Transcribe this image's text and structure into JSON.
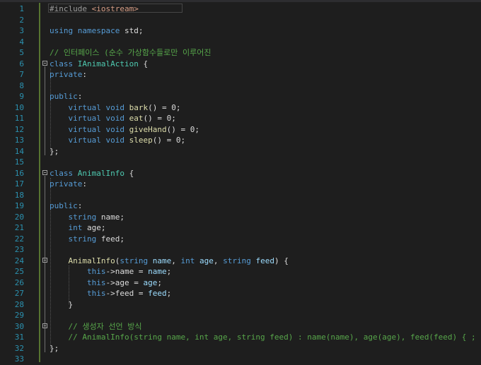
{
  "editor": {
    "lines": [
      {
        "n": "1",
        "segs": [
          {
            "c": "pp",
            "t": "#include "
          },
          {
            "c": "str",
            "t": "<iostream>"
          }
        ]
      },
      {
        "n": "2",
        "segs": []
      },
      {
        "n": "3",
        "segs": [
          {
            "c": "kw",
            "t": "using namespace "
          },
          {
            "c": "id",
            "t": "std;"
          }
        ]
      },
      {
        "n": "4",
        "segs": []
      },
      {
        "n": "5",
        "segs": [
          {
            "c": "cm",
            "t": "// 인터페이스 (순수 가상함수들로만 이루어진"
          }
        ]
      },
      {
        "n": "6",
        "segs": [
          {
            "c": "kw",
            "t": "class "
          },
          {
            "c": "ty",
            "t": "IAnimalAction"
          },
          {
            "c": "id",
            "t": " {"
          }
        ]
      },
      {
        "n": "7",
        "segs": [
          {
            "c": "kw",
            "t": "private"
          },
          {
            "c": "id",
            "t": ":"
          }
        ]
      },
      {
        "n": "8",
        "segs": []
      },
      {
        "n": "9",
        "segs": [
          {
            "c": "kw",
            "t": "public"
          },
          {
            "c": "id",
            "t": ":"
          }
        ]
      },
      {
        "n": "10",
        "segs": [
          {
            "c": "id",
            "t": "    "
          },
          {
            "c": "kw",
            "t": "virtual void "
          },
          {
            "c": "fn",
            "t": "bark"
          },
          {
            "c": "id",
            "t": "() = 0;"
          }
        ]
      },
      {
        "n": "11",
        "segs": [
          {
            "c": "id",
            "t": "    "
          },
          {
            "c": "kw",
            "t": "virtual void "
          },
          {
            "c": "fn",
            "t": "eat"
          },
          {
            "c": "id",
            "t": "() = 0;"
          }
        ]
      },
      {
        "n": "12",
        "segs": [
          {
            "c": "id",
            "t": "    "
          },
          {
            "c": "kw",
            "t": "virtual void "
          },
          {
            "c": "fn",
            "t": "giveHand"
          },
          {
            "c": "id",
            "t": "() = 0;"
          }
        ]
      },
      {
        "n": "13",
        "segs": [
          {
            "c": "id",
            "t": "    "
          },
          {
            "c": "kw",
            "t": "virtual void "
          },
          {
            "c": "fn",
            "t": "sleep"
          },
          {
            "c": "id",
            "t": "() = 0;"
          }
        ]
      },
      {
        "n": "14",
        "segs": [
          {
            "c": "id",
            "t": "};"
          }
        ]
      },
      {
        "n": "15",
        "segs": []
      },
      {
        "n": "16",
        "segs": [
          {
            "c": "kw",
            "t": "class "
          },
          {
            "c": "ty",
            "t": "AnimalInfo"
          },
          {
            "c": "id",
            "t": " {"
          }
        ]
      },
      {
        "n": "17",
        "segs": [
          {
            "c": "kw",
            "t": "private"
          },
          {
            "c": "id",
            "t": ":"
          }
        ]
      },
      {
        "n": "18",
        "segs": []
      },
      {
        "n": "19",
        "segs": [
          {
            "c": "kw",
            "t": "public"
          },
          {
            "c": "id",
            "t": ":"
          }
        ]
      },
      {
        "n": "20",
        "segs": [
          {
            "c": "id",
            "t": "    "
          },
          {
            "c": "kw",
            "t": "string "
          },
          {
            "c": "id",
            "t": "name;"
          }
        ]
      },
      {
        "n": "21",
        "segs": [
          {
            "c": "id",
            "t": "    "
          },
          {
            "c": "kw",
            "t": "int "
          },
          {
            "c": "id",
            "t": "age;"
          }
        ]
      },
      {
        "n": "22",
        "segs": [
          {
            "c": "id",
            "t": "    "
          },
          {
            "c": "kw",
            "t": "string "
          },
          {
            "c": "id",
            "t": "feed;"
          }
        ]
      },
      {
        "n": "23",
        "segs": []
      },
      {
        "n": "24",
        "segs": [
          {
            "c": "id",
            "t": "    "
          },
          {
            "c": "fn",
            "t": "AnimalInfo"
          },
          {
            "c": "id",
            "t": "("
          },
          {
            "c": "kw",
            "t": "string "
          },
          {
            "c": "pr",
            "t": "name"
          },
          {
            "c": "id",
            "t": ", "
          },
          {
            "c": "kw",
            "t": "int "
          },
          {
            "c": "pr",
            "t": "age"
          },
          {
            "c": "id",
            "t": ", "
          },
          {
            "c": "kw",
            "t": "string "
          },
          {
            "c": "pr",
            "t": "feed"
          },
          {
            "c": "id",
            "t": ") {"
          }
        ]
      },
      {
        "n": "25",
        "segs": [
          {
            "c": "id",
            "t": "        "
          },
          {
            "c": "kw",
            "t": "this"
          },
          {
            "c": "id",
            "t": "->name = "
          },
          {
            "c": "pr",
            "t": "name"
          },
          {
            "c": "id",
            "t": ";"
          }
        ]
      },
      {
        "n": "26",
        "segs": [
          {
            "c": "id",
            "t": "        "
          },
          {
            "c": "kw",
            "t": "this"
          },
          {
            "c": "id",
            "t": "->age = "
          },
          {
            "c": "pr",
            "t": "age"
          },
          {
            "c": "id",
            "t": ";"
          }
        ]
      },
      {
        "n": "27",
        "segs": [
          {
            "c": "id",
            "t": "        "
          },
          {
            "c": "kw",
            "t": "this"
          },
          {
            "c": "id",
            "t": "->feed = "
          },
          {
            "c": "pr",
            "t": "feed"
          },
          {
            "c": "id",
            "t": ";"
          }
        ]
      },
      {
        "n": "28",
        "segs": [
          {
            "c": "id",
            "t": "    }"
          }
        ]
      },
      {
        "n": "29",
        "segs": []
      },
      {
        "n": "30",
        "segs": [
          {
            "c": "id",
            "t": "    "
          },
          {
            "c": "cm",
            "t": "// 생성자 선언 방식"
          }
        ]
      },
      {
        "n": "31",
        "segs": [
          {
            "c": "id",
            "t": "    "
          },
          {
            "c": "cm",
            "t": "// AnimalInfo(string name, int age, string feed) : name(name), age(age), feed(feed) { ; }"
          }
        ]
      },
      {
        "n": "32",
        "segs": [
          {
            "c": "id",
            "t": "};"
          }
        ]
      },
      {
        "n": "33",
        "segs": []
      }
    ]
  }
}
